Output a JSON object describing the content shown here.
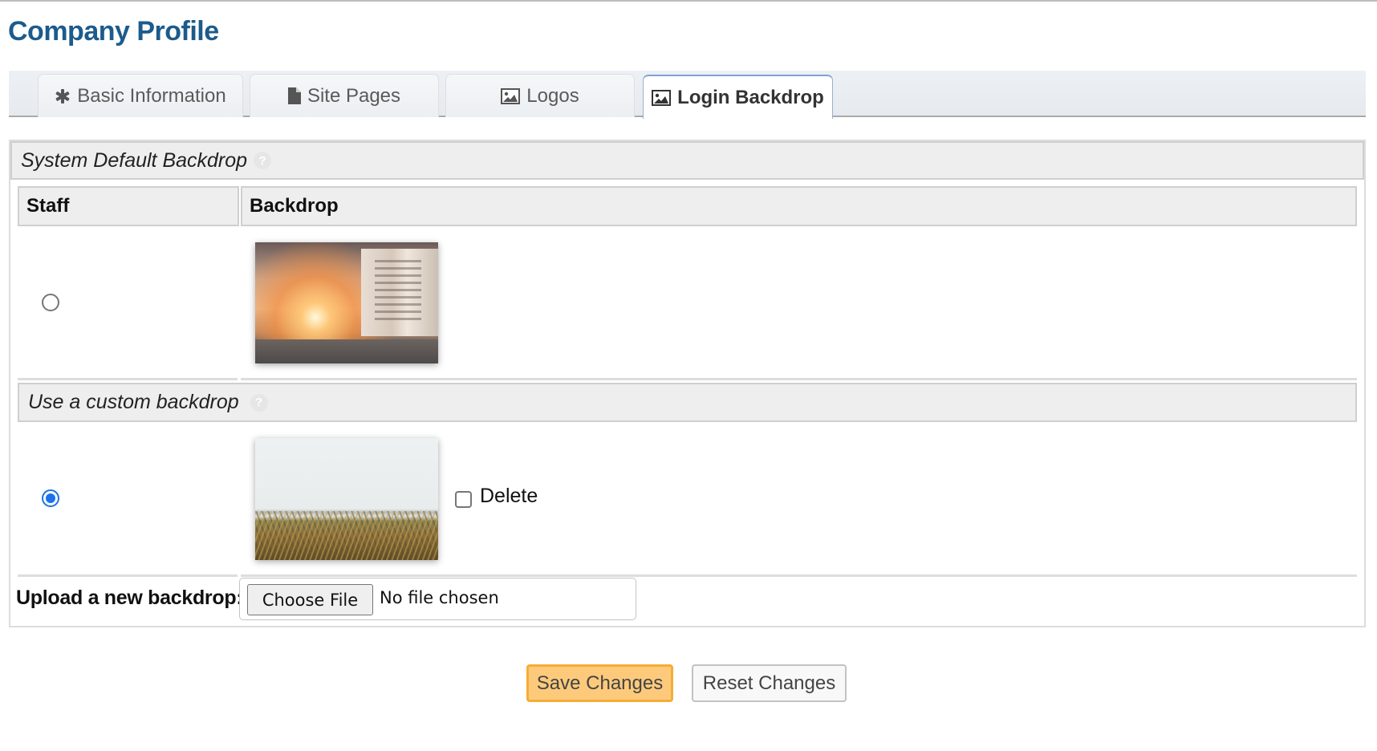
{
  "page": {
    "title": "Company Profile"
  },
  "tabs": [
    {
      "label": "Basic Information",
      "icon": "asterisk-icon",
      "active": false
    },
    {
      "label": "Site Pages",
      "icon": "file-icon",
      "active": false
    },
    {
      "label": "Logos",
      "icon": "image-icon",
      "active": false
    },
    {
      "label": "Login Backdrop",
      "icon": "image-icon",
      "active": true
    }
  ],
  "system_default": {
    "heading": "System Default Backdrop",
    "help_icon": "?",
    "columns": [
      "Staff",
      "Backdrop"
    ],
    "row": {
      "selected": false,
      "image_alt": "city street at sunset backdrop"
    }
  },
  "custom": {
    "heading": "Use a custom backdrop",
    "help_icon": "?",
    "row": {
      "selected": true,
      "image_alt": "beach dune grass backdrop",
      "delete_label": "Delete",
      "delete_checked": false
    }
  },
  "upload": {
    "label": "Upload a new backdrop:",
    "button_label": "Choose File",
    "status": "No file chosen"
  },
  "actions": {
    "save_label": "Save Changes",
    "reset_label": "Reset Changes"
  },
  "colors": {
    "title": "#1c5b8c",
    "save_bg": "#fdca7b",
    "save_border": "#f7ac36",
    "radio_checked": "#1a73e8"
  }
}
